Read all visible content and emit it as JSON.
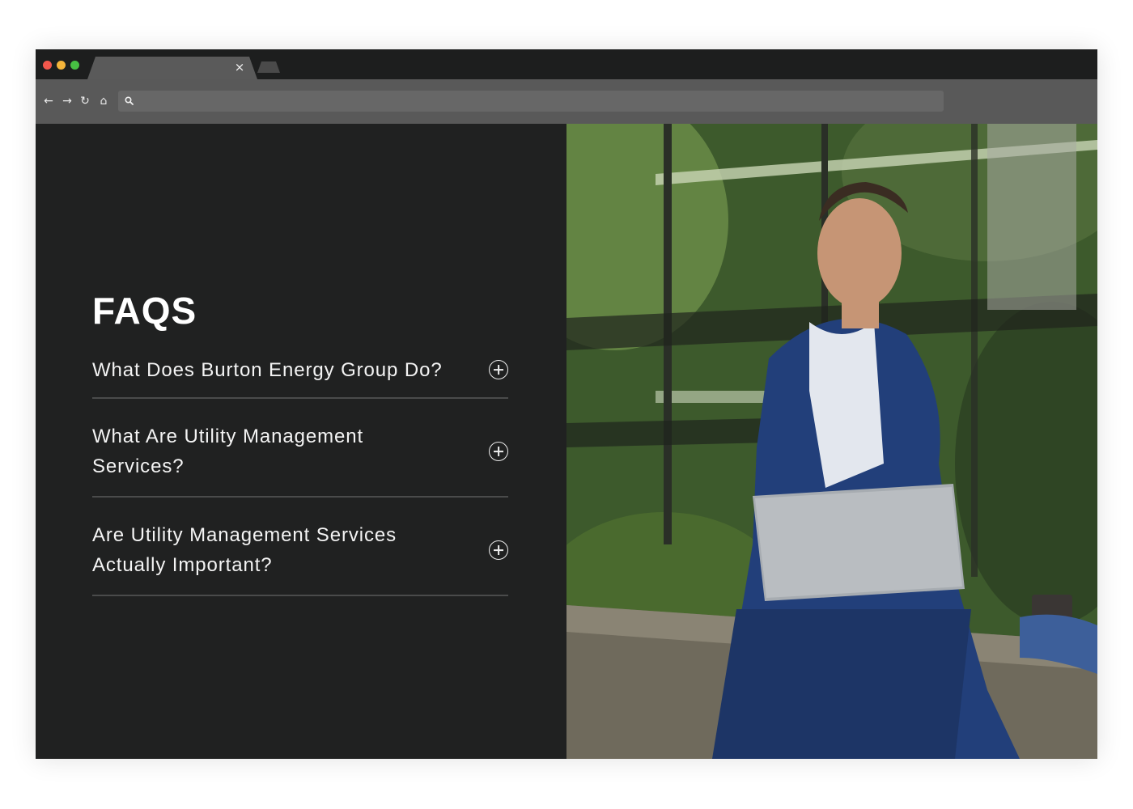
{
  "browser": {
    "tab_close": "×",
    "nav": {
      "back": "←",
      "forward": "→",
      "reload": "↻",
      "home": "⌂"
    },
    "url": ""
  },
  "faq": {
    "heading": "FAQS",
    "items": [
      {
        "question": "What Does Burton Energy Group Do?",
        "icon": "plus-circle-icon"
      },
      {
        "question": "What Are Utility Management Services?",
        "icon": "plus-circle-icon"
      },
      {
        "question": "Are Utility Management Services Actually Important?",
        "icon": "plus-circle-icon"
      }
    ]
  },
  "hero_image": {
    "subject": "man-in-blue-suit-using-laptop-outdoors"
  },
  "colors": {
    "page_bg": "#202121",
    "divider": "#4a4b4b",
    "toolbar": "#595959"
  }
}
